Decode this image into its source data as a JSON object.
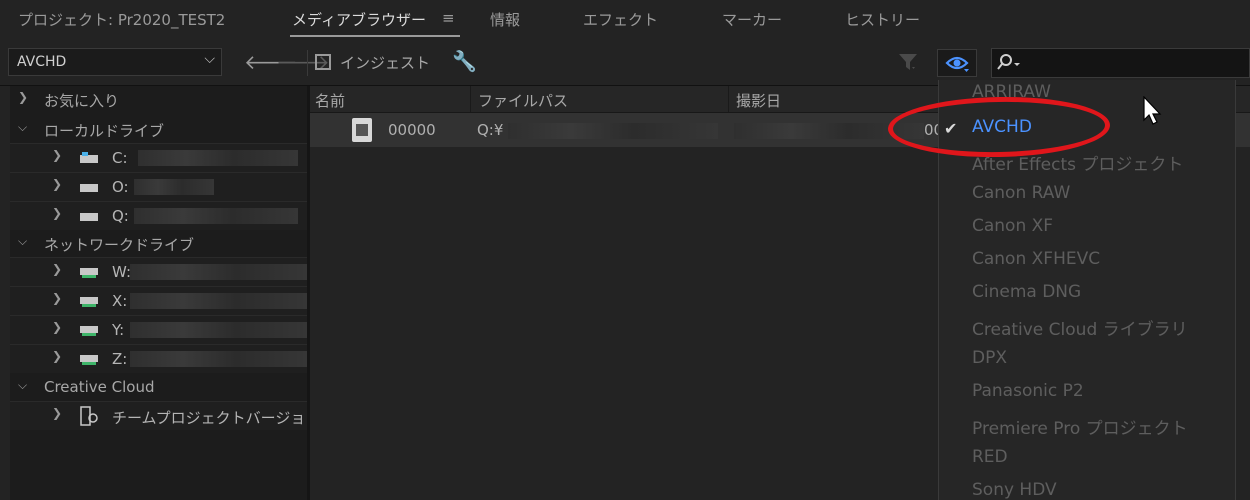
{
  "tabs": [
    {
      "label": "プロジェクト: Pr2020_TEST2",
      "active": false
    },
    {
      "label": "メディアブラウザー",
      "active": true
    },
    {
      "label": "情報",
      "active": false
    },
    {
      "label": "エフェクト",
      "active": false
    },
    {
      "label": "マーカー",
      "active": false
    },
    {
      "label": "ヒストリー",
      "active": false
    }
  ],
  "tab_menu_icon": "hamburger-icon",
  "toolbar": {
    "drive_select_value": "AVCHD",
    "ingest_label": "インジェスト",
    "ingest_checked": false,
    "search_value": ""
  },
  "tree": {
    "favorites": "お気に入り",
    "local": "ローカルドライブ",
    "local_drives": [
      "C:",
      "O:",
      "Q:"
    ],
    "network": "ネットワークドライブ",
    "network_drives": [
      "W:",
      "X:",
      "Y:",
      "Z:"
    ],
    "cloud": "Creative Cloud",
    "cloud_items": [
      "チームプロジェクトバージョ"
    ]
  },
  "file_table": {
    "columns": [
      "名前",
      "ファイルパス",
      "撮影日"
    ],
    "rows": [
      {
        "name": "00000",
        "path": "Q:¥"
      }
    ],
    "date_fragment": "00"
  },
  "dropdown": {
    "selected": "AVCHD",
    "items": [
      "ARRIRAW",
      "AVCHD",
      "After Effects プロジェクト",
      "Canon RAW",
      "Canon XF",
      "Canon XFHEVC",
      "Cinema DNG",
      "Creative Cloud ライブラリ",
      "DPX",
      "Panasonic P2",
      "Premiere Pro プロジェクト",
      "RED",
      "Sony HDV"
    ]
  },
  "colors": {
    "accent": "#4b92ff",
    "highlight_circle": "#e0161b",
    "background": "#232323"
  }
}
